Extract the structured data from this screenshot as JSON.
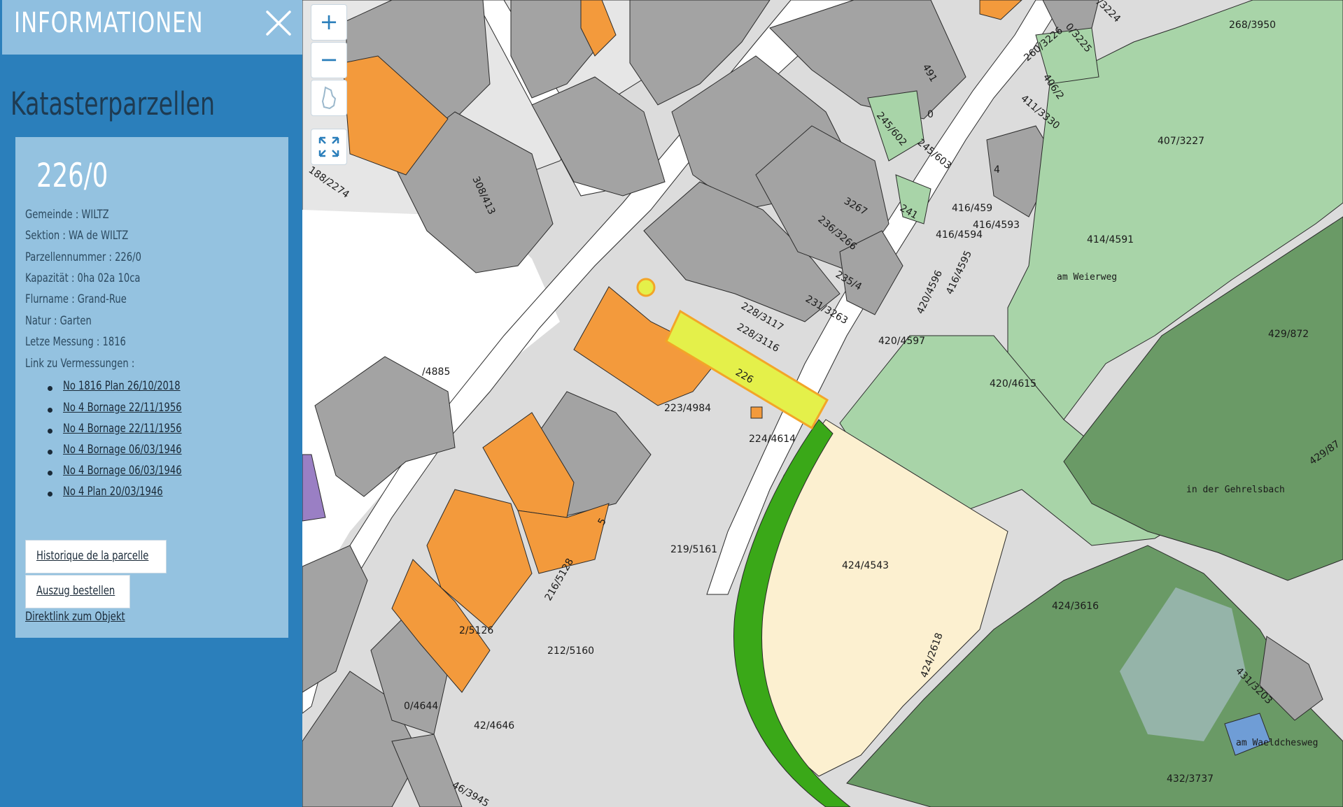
{
  "panel": {
    "header_title": "INFORMATIONEN",
    "section_title": "Katasterparzellen",
    "parcel_number": "226/0",
    "attributes": [
      "Gemeinde : WILTZ",
      "Sektion : WA de WILTZ",
      "Parzellennummer : 226/0",
      "Kapazität : 0ha 02a 10ca",
      "Flurname : Grand-Rue",
      "Natur : Garten",
      "Letze Messung : 1816",
      "Link zu Vermessungen :"
    ],
    "survey_links": [
      "No 1816 Plan 26/10/2018",
      "No 4 Bornage 22/11/1956",
      "No 4 Bornage 22/11/1956",
      "No 4 Bornage 06/03/1946",
      "No 4 Bornage 06/03/1946",
      "No 4 Plan 20/03/1946"
    ],
    "history_button": "Historique de la parcelle",
    "extract_button": "Auszug bestellen",
    "direct_link": "Direktlink zum Objekt"
  },
  "map_controls": {
    "zoom_in": "+",
    "zoom_out": "−"
  },
  "map_labels": {
    "l1": "226",
    "l2": "228/3116",
    "l3": "228/3117",
    "l4": "231/3263",
    "l5": "223/4984",
    "l6": "224/4614",
    "l7": "219/5161",
    "l8": "212/5160",
    "l9": "216/5128",
    "l10": "2/5126",
    "l11": "42/4646",
    "l12": "0/4644",
    "l13": "46/3945",
    "l14": "/4885",
    "l15": "188/2274",
    "l16": "308/413",
    "l17": "245/602",
    "l18": "245/603",
    "l19": "241",
    "l20": "236/3266",
    "l21": "235/4",
    "l22": "3267",
    "l23": "416/4594",
    "l24": "416/4593",
    "l25": "416/459",
    "l26": "420/4596",
    "l27": "416/4595",
    "l28": "420/4597",
    "l29": "414/4591",
    "l30": "am Weierweg",
    "l31": "407/3227",
    "l32": "268/3950",
    "l33": "406/2",
    "l34": "411/3330",
    "l35": "260/3226",
    "l36": "0/3225",
    "l37": "/3224",
    "l38": "420/4615",
    "l39": "429/872",
    "l40": "429/87",
    "l41": "in der Gehrelsbach",
    "l42": "424/4543",
    "l43": "424/3616",
    "l44": "424/2618",
    "l45": "431/3203",
    "l46": "am Waeldchesweg",
    "l47": "432/3737",
    "l48": "491",
    "l49": "0",
    "l50": "5",
    "l51": "4"
  },
  "colors": {
    "building_orange": "#f39a3c",
    "building_gray": "#a3a3a3",
    "parcel_gray": "#dcdcdc",
    "highlight": "#e4f04a",
    "green_light": "#a8d4a8",
    "green_dark": "#6a9a66",
    "green_strip": "#3aa818",
    "cream": "#fcf0d0",
    "sidebar_blue": "#2b7fbb"
  }
}
